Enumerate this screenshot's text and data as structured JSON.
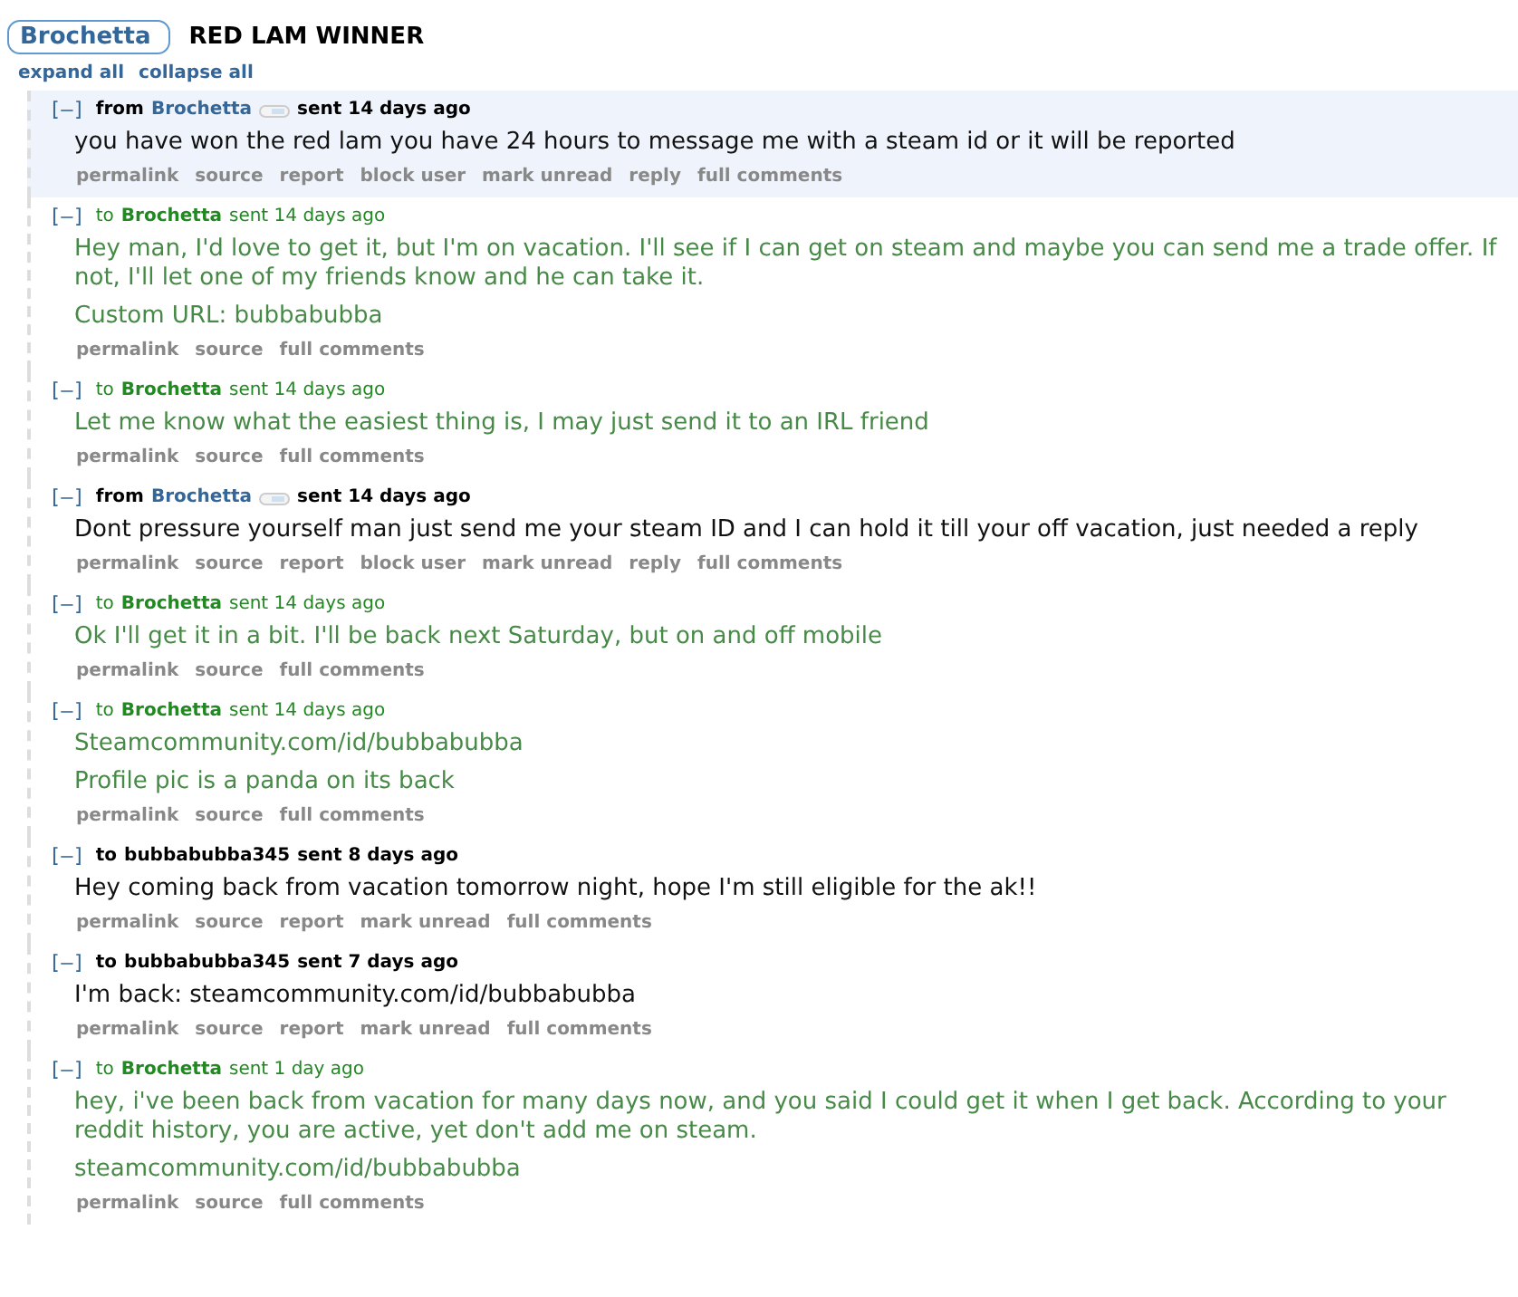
{
  "header": {
    "user": "Brochetta",
    "subject": "RED LAM WINNER"
  },
  "thread_links": [
    "expand all",
    "collapse all"
  ],
  "messages": [
    {
      "kind": "received",
      "highlighted": true,
      "toggle": "[–]",
      "prefix": "from",
      "author": "Brochetta",
      "time": "sent 14 days ago",
      "paragraphs": [
        "you have won the red lam you have 24 hours to message me with a steam id or it will be reported"
      ],
      "actions": [
        "permalink",
        "source",
        "report",
        "block user",
        "mark unread",
        "reply",
        "full comments"
      ]
    },
    {
      "kind": "sent",
      "highlighted": false,
      "toggle": "[–]",
      "prefix": "to",
      "author": "Brochetta",
      "time": "sent 14 days ago",
      "paragraphs": [
        "Hey man, I'd love to get it, but I'm on vacation. I'll see if I can get on steam and maybe you can send me a trade offer. If not, I'll let one of my friends know and he can take it.",
        "Custom URL: bubbabubba"
      ],
      "actions": [
        "permalink",
        "source",
        "full comments"
      ]
    },
    {
      "kind": "sent",
      "highlighted": false,
      "toggle": "[–]",
      "prefix": "to",
      "author": "Brochetta",
      "time": "sent 14 days ago",
      "paragraphs": [
        "Let me know what the easiest thing is, I may just send it to an IRL friend"
      ],
      "actions": [
        "permalink",
        "source",
        "full comments"
      ]
    },
    {
      "kind": "received",
      "highlighted": false,
      "toggle": "[–]",
      "prefix": "from",
      "author": "Brochetta",
      "time": "sent 14 days ago",
      "paragraphs": [
        "Dont pressure yourself man just send me your steam ID and I can hold it till your off vacation, just needed a reply"
      ],
      "actions": [
        "permalink",
        "source",
        "report",
        "block user",
        "mark unread",
        "reply",
        "full comments"
      ]
    },
    {
      "kind": "sent",
      "highlighted": false,
      "toggle": "[–]",
      "prefix": "to",
      "author": "Brochetta",
      "time": "sent 14 days ago",
      "paragraphs": [
        "Ok I'll get it in a bit. I'll be back next Saturday, but on and off mobile"
      ],
      "actions": [
        "permalink",
        "source",
        "full comments"
      ]
    },
    {
      "kind": "sent",
      "highlighted": false,
      "toggle": "[–]",
      "prefix": "to",
      "author": "Brochetta",
      "time": "sent 14 days ago",
      "paragraphs": [
        "Steamcommunity.com/id/bubbabubba",
        "Profile pic is a panda on its back"
      ],
      "actions": [
        "permalink",
        "source",
        "full comments"
      ]
    },
    {
      "kind": "sent_plain",
      "highlighted": false,
      "toggle": "[–]",
      "prefix": "to",
      "author": "bubbabubba345",
      "time": "sent 8 days ago",
      "paragraphs": [
        "Hey coming back from vacation tomorrow night, hope I'm still eligible for the ak!!"
      ],
      "actions": [
        "permalink",
        "source",
        "report",
        "mark unread",
        "full comments"
      ]
    },
    {
      "kind": "sent_plain",
      "highlighted": false,
      "toggle": "[–]",
      "prefix": "to",
      "author": "bubbabubba345",
      "time": "sent 7 days ago",
      "paragraphs": [
        "I'm back: steamcommunity.com/id/bubbabubba"
      ],
      "actions": [
        "permalink",
        "source",
        "report",
        "mark unread",
        "full comments"
      ]
    },
    {
      "kind": "sent",
      "highlighted": false,
      "toggle": "[–]",
      "prefix": "to",
      "author": "Brochetta",
      "time": "sent 1 day ago",
      "paragraphs": [
        "hey, i've been back from vacation for many days now, and you said I could get it when I get back. According to your reddit history, you are active, yet don't add me on steam.",
        "steamcommunity.com/id/bubbabubba"
      ],
      "actions": [
        "permalink",
        "source",
        "full comments"
      ]
    }
  ]
}
